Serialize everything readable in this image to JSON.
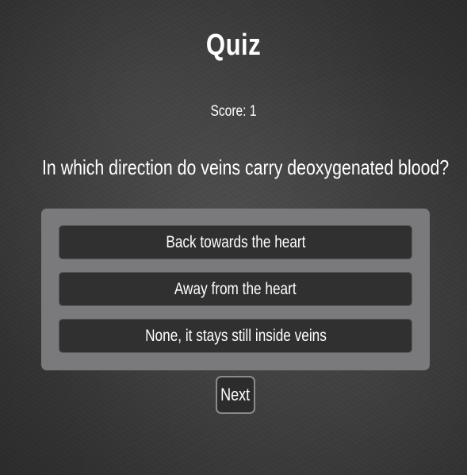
{
  "quiz": {
    "title": "Quiz",
    "score": "Score: 1",
    "question": "In which direction do veins carry deoxygenated blood?",
    "answers": [
      {
        "label": "Back towards the heart"
      },
      {
        "label": "Away from the heart"
      },
      {
        "label": "None, it stays still inside veins"
      }
    ],
    "next_label": "Next"
  },
  "colors": {
    "background": "#3a3a3a",
    "panel": "#7a7a7c",
    "answer_button": "#303030",
    "text": "#ffffff"
  }
}
